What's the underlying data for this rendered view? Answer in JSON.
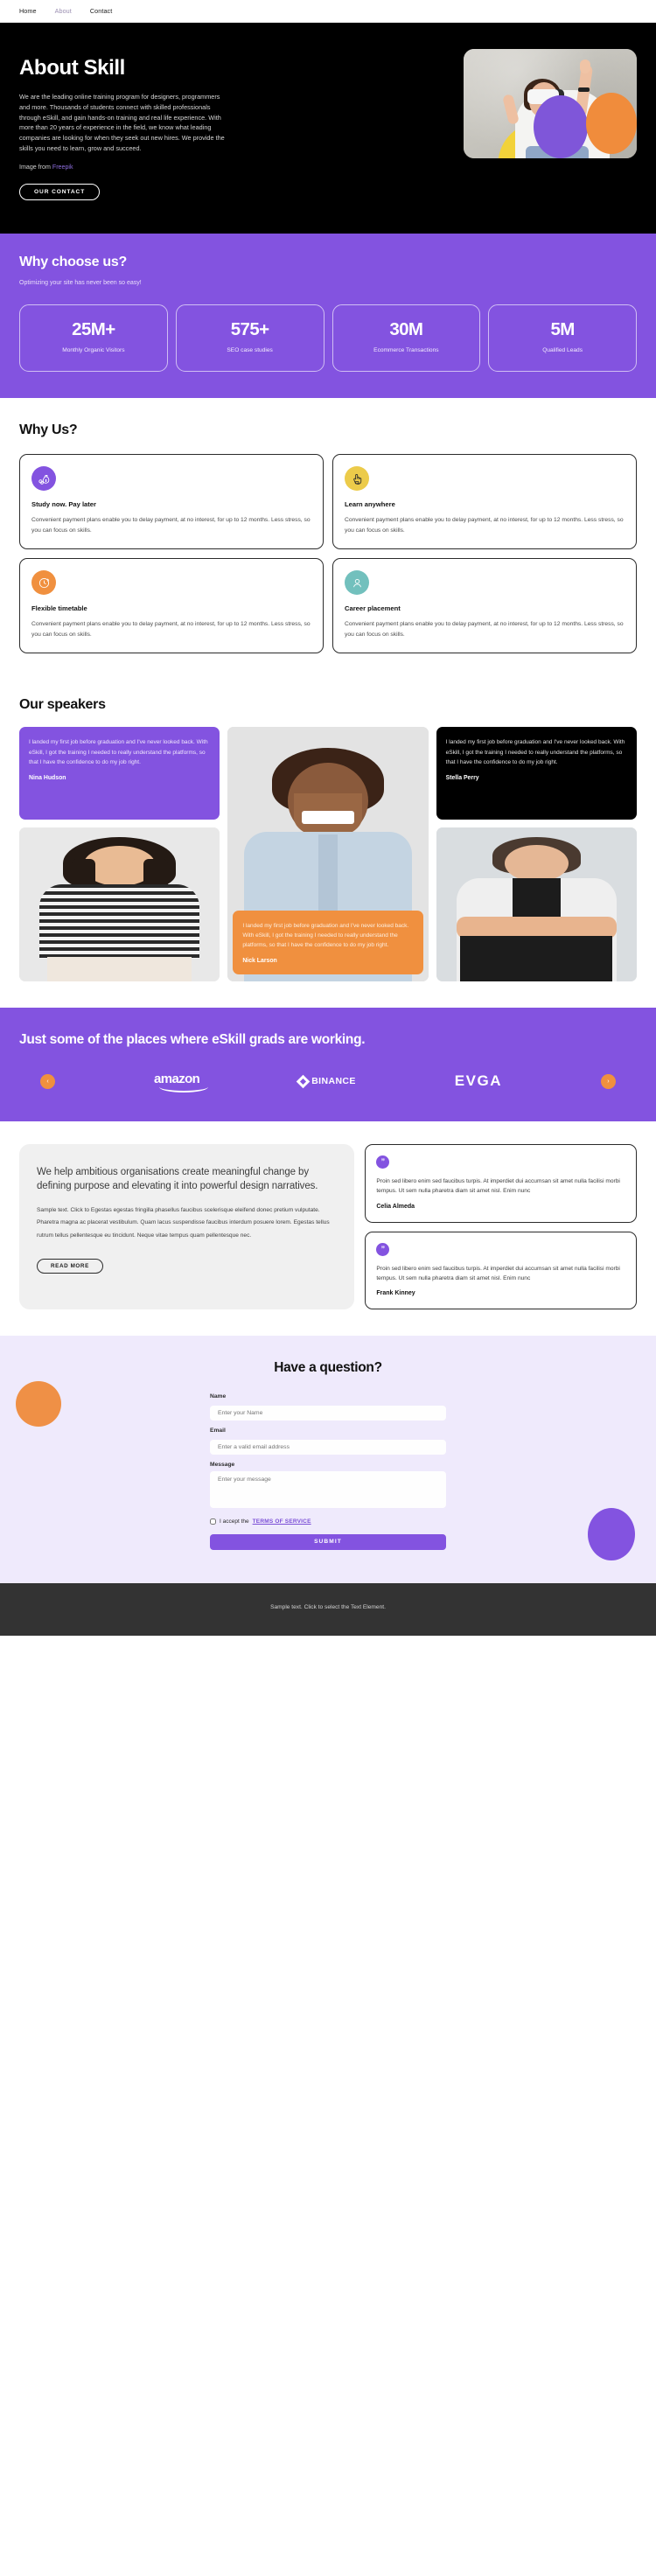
{
  "nav": {
    "items": [
      {
        "label": "Home",
        "active": false
      },
      {
        "label": "About",
        "active": true
      },
      {
        "label": "Contact",
        "active": false
      }
    ]
  },
  "hero": {
    "title": "About Skill",
    "body": "We are the leading online training program for designers, programmers and more. Thousands of students connect with skilled professionals through eSkill, and gain hands-on training and real life experience. With more than 20 years of experience in the field, we know what leading companies are looking for when they seek out new hires. We provide the skills you need to learn, grow and succeed.",
    "credit_prefix": "Image from",
    "credit_link": "Freepik",
    "cta": "OUR CONTACT",
    "bg_color": "#000000",
    "accent_purple": "#7f56d9",
    "accent_orange": "#f08c3c"
  },
  "stats": {
    "heading": "Why choose us?",
    "subheading": "Optimizing your site has never been so easy!",
    "bg_color": "#8353e0",
    "items": [
      {
        "value": "25M+",
        "label": "Monthly Organic Visitors"
      },
      {
        "value": "575+",
        "label": "SEO case studies"
      },
      {
        "value": "30M",
        "label": "Ecommerce Transactions"
      },
      {
        "value": "5M",
        "label": "Qualified Leads"
      }
    ]
  },
  "whyus": {
    "heading": "Why Us?",
    "cards": [
      {
        "icon": "money-bag-icon",
        "icon_bg": "#8353e0",
        "title": "Study now. Pay later",
        "body": "Convenient payment plans enable you to delay payment, at no interest, for up to 12 months. Less stress, so you can focus on skills."
      },
      {
        "icon": "hand-tap-icon",
        "icon_bg": "#eccb4a",
        "title": "Learn anywhere",
        "body": "Convenient payment plans enable you to delay payment, at no interest, for up to 12 months. Less stress, so you can focus on skills."
      },
      {
        "icon": "clock-arrow-icon",
        "icon_bg": "#f0903f",
        "title": "Flexible timetable",
        "body": "Convenient payment plans enable you to delay payment, at no interest, for up to 12 months. Less stress, so you can focus on skills."
      },
      {
        "icon": "user-badge-icon",
        "icon_bg": "#72c0bd",
        "title": "Career placement",
        "body": "Convenient payment plans enable you to delay payment, at no interest, for up to 12 months. Less stress, so you can focus on skills."
      }
    ]
  },
  "speakers": {
    "heading": "Our speakers",
    "quote_text": "I landed my first job before graduation and I've never looked back. With eSkill, I got the training I needed to really understand the platforms, so that I have the confidence to do my job right.",
    "cards": [
      {
        "name": "Nina Hudson",
        "theme": "purple"
      },
      {
        "name": "Stella Perry",
        "theme": "black"
      },
      {
        "name": "Nick Larson",
        "theme": "orange"
      }
    ],
    "photos": [
      {
        "alt": "smiling-man-portrait"
      },
      {
        "alt": "smiling-woman-striped-shirt-portrait"
      },
      {
        "alt": "woman-arms-crossed-portrait"
      }
    ]
  },
  "brands": {
    "heading": "Just some of the places where eSkill grads are working.",
    "bg_color": "#8353e0",
    "prev_label": "‹",
    "next_label": "›",
    "logos": [
      {
        "name": "amazon",
        "text": "amazon"
      },
      {
        "name": "binance",
        "text": "BINANCE"
      },
      {
        "name": "evga",
        "text": "EVGA"
      }
    ]
  },
  "about": {
    "headline": "We help ambitious organisations create meaningful change by defining purpose and elevating it into powerful design narratives.",
    "body": "Sample text. Click to Egestas egestas fringilla phasellus faucibus scelerisque eleifend donec pretium vulputate. Pharetra magna ac placerat vestibulum. Quam lacus suspendisse faucibus interdum posuere lorem. Egestas tellus rutrum tellus pellentesque eu tincidunt. Neque vitae tempus quam pellentesque nec.",
    "cta": "READ MORE",
    "reviews": [
      {
        "quote_glyph": "”",
        "text": "Proin sed libero enim sed faucibus turpis. At imperdiet dui accumsan sit amet nulla facilisi morbi tempus. Ut sem nulla pharetra diam sit amet nisl. Enim nunc",
        "author": "Celia Almeda"
      },
      {
        "quote_glyph": "”",
        "text": "Proin sed libero enim sed faucibus turpis. At imperdiet dui accumsan sit amet nulla facilisi morbi tempus. Ut sem nulla pharetra diam sit amet nisl. Enim nunc",
        "author": "Frank Kinney"
      }
    ]
  },
  "contact": {
    "heading": "Have a question?",
    "bg_color": "#efeafc",
    "fields": {
      "name_label": "Name",
      "name_placeholder": "Enter your Name",
      "email_label": "Email",
      "email_placeholder": "Enter a valid email address",
      "message_label": "Message",
      "message_placeholder": "Enter your message"
    },
    "consent_text": "I accept the",
    "terms_link": "TERMS OF SERVICE",
    "submit_label": "SUBMIT"
  },
  "footer": {
    "text": "Sample text. Click to select the Text Element."
  }
}
